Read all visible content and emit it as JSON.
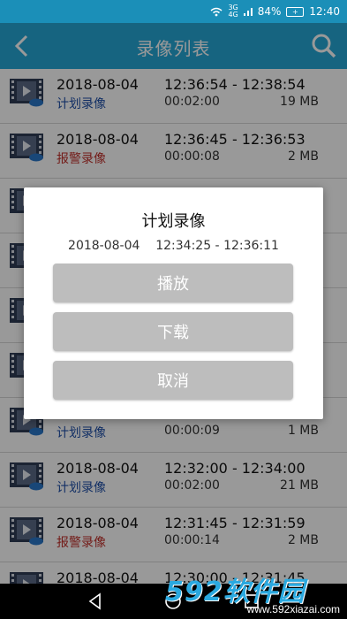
{
  "status_bar": {
    "network_top": "3G",
    "network_bottom": "4G",
    "battery": "84%",
    "time": "12:40"
  },
  "app_bar": {
    "title": "录像列表",
    "back_icon": "chevron-left-icon",
    "search_icon": "search-icon"
  },
  "colors": {
    "accent": "#26a7d6",
    "plan": "#1e4fa8",
    "alarm": "#c0302b"
  },
  "recordings": [
    {
      "date": "2018-08-04",
      "type": "计划录像",
      "kind": "plan",
      "time": "12:36:54 - 12:38:54",
      "duration": "00:02:00",
      "size": "19 MB"
    },
    {
      "date": "2018-08-04",
      "type": "报警录像",
      "kind": "alarm",
      "time": "12:36:45 - 12:36:53",
      "duration": "00:00:08",
      "size": "2 MB"
    },
    {
      "date": "",
      "type": "",
      "kind": "plan",
      "time": "",
      "duration": "",
      "size": ""
    },
    {
      "date": "",
      "type": "",
      "kind": "plan",
      "time": "",
      "duration": "",
      "size": ""
    },
    {
      "date": "",
      "type": "",
      "kind": "plan",
      "time": "",
      "duration": "",
      "size": ""
    },
    {
      "date": "",
      "type": "",
      "kind": "plan",
      "time": "",
      "duration": "",
      "size": ""
    },
    {
      "date": "",
      "type": "计划录像",
      "kind": "plan",
      "time": "",
      "duration": "00:00:09",
      "size": "1 MB"
    },
    {
      "date": "2018-08-04",
      "type": "计划录像",
      "kind": "plan",
      "time": "12:32:00 - 12:34:00",
      "duration": "00:02:00",
      "size": "21 MB"
    },
    {
      "date": "2018-08-04",
      "type": "报警录像",
      "kind": "alarm",
      "time": "12:31:45 - 12:31:59",
      "duration": "00:00:14",
      "size": "2 MB"
    },
    {
      "date": "2018-08-04",
      "type": "",
      "kind": "plan",
      "time": "12:30:00 - 12:31:45",
      "duration": "",
      "size": ""
    }
  ],
  "dialog": {
    "title": "计划录像",
    "date": "2018-08-04",
    "time_range": "12:34:25 - 12:36:11",
    "play_label": "播放",
    "download_label": "下载",
    "cancel_label": "取消"
  },
  "watermark": {
    "logo": "592软件园",
    "url": "www.592xiazai.com"
  }
}
